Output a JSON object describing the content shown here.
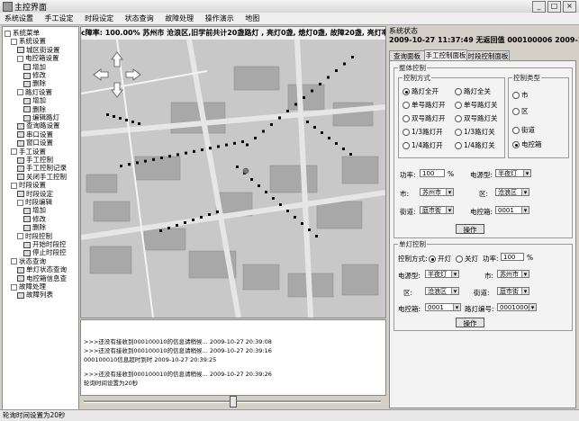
{
  "window": {
    "title": "主控界面",
    "min": "_",
    "max": "□",
    "close": "×"
  },
  "menu": [
    "系统设置",
    "手工设定",
    "时段设定",
    "状态查询",
    "故障处理",
    "操作演示",
    "地图"
  ],
  "tree": [
    {
      "label": "系统菜单",
      "level": 0,
      "kind": "pm"
    },
    {
      "label": "系统设置",
      "level": 1,
      "kind": "pm"
    },
    {
      "label": "城区街设置",
      "level": 2,
      "kind": "fi"
    },
    {
      "label": "电控箱设置",
      "level": 2,
      "kind": "pm"
    },
    {
      "label": "增加",
      "level": 3,
      "kind": "fi"
    },
    {
      "label": "修改",
      "level": 3,
      "kind": "fi"
    },
    {
      "label": "删除",
      "level": 3,
      "kind": "fi"
    },
    {
      "label": "路灯设置",
      "level": 2,
      "kind": "pm"
    },
    {
      "label": "增加",
      "level": 3,
      "kind": "fi"
    },
    {
      "label": "删除",
      "level": 3,
      "kind": "fi"
    },
    {
      "label": "编辑路灯",
      "level": 3,
      "kind": "fi"
    },
    {
      "label": "查询路设置",
      "level": 2,
      "kind": "fi"
    },
    {
      "label": "串口设置",
      "level": 2,
      "kind": "fi"
    },
    {
      "label": "窗口设置",
      "level": 2,
      "kind": "fi"
    },
    {
      "label": "手工设置",
      "level": 1,
      "kind": "pm"
    },
    {
      "label": "手工控制",
      "level": 2,
      "kind": "fi"
    },
    {
      "label": "手工控制记录",
      "level": 2,
      "kind": "fi"
    },
    {
      "label": "关闭手工控制",
      "level": 2,
      "kind": "fi"
    },
    {
      "label": "时段设置",
      "level": 1,
      "kind": "pm"
    },
    {
      "label": "时段设定",
      "level": 2,
      "kind": "fi"
    },
    {
      "label": "时段编辑",
      "level": 2,
      "kind": "pm"
    },
    {
      "label": "增加",
      "level": 3,
      "kind": "fi"
    },
    {
      "label": "修改",
      "level": 3,
      "kind": "fi"
    },
    {
      "label": "删除",
      "level": 3,
      "kind": "fi"
    },
    {
      "label": "时段控制",
      "level": 2,
      "kind": "pm"
    },
    {
      "label": "开始时段控",
      "level": 3,
      "kind": "fi"
    },
    {
      "label": "停止时段控",
      "level": 3,
      "kind": "fi"
    },
    {
      "label": "状态查询",
      "level": 1,
      "kind": "pm"
    },
    {
      "label": "单灯状态查询",
      "level": 2,
      "kind": "fi"
    },
    {
      "label": "电控箱信息查",
      "level": 2,
      "kind": "fi"
    },
    {
      "label": "故障处理",
      "level": 1,
      "kind": "pm"
    },
    {
      "label": "故障列表",
      "level": 2,
      "kind": "fi"
    }
  ],
  "map_status": "c障率: 100.00%    苏州市 沧浪区,旧学前共计20盏路灯 , 亮灯0盏, 熄灯0盏, 故障20盏, 亮灯率",
  "log": [
    ">>>还没有接收到000100010的信息请稍候...  2009-10-27 20:39:08",
    ">>>还没有接收到000100010的信息请稍候...  2009-10-27 20:39:16",
    "000100010信息超时到时 2009-10-27 20:39:25",
    ">>>还没有接收到000100010的信息请稍候...  2009-10-27 20:39:26",
    "轮询时间设置为20秒"
  ],
  "status_bar": "轮询时间设置为20秒",
  "right": {
    "header": "系统状态",
    "clock": "2009-10-27 11:37:49  无返回值 000100006   2009-10-27",
    "tabs": [
      "查询面板",
      "手工控制面板",
      "时段控制面板"
    ],
    "group_all": "整体控制",
    "group_mode": "控制方式",
    "modes": [
      "全开",
      "全关",
      "单号开",
      "单号关",
      "双号开",
      "双号关",
      "1/3开",
      "1/3关",
      "1/4开",
      "1/4关"
    ],
    "mode_labels": [
      "路灯全开",
      "路灯全关",
      "单号路灯开",
      "单号路灯关",
      "双号路灯开",
      "双号路灯关",
      "1/3路灯开",
      "1/3路灯关",
      "1/4路灯开",
      "1/4路灯关"
    ],
    "group_type": "控制类型",
    "types": [
      "市",
      "区",
      "街道",
      "电控箱"
    ],
    "power_label": "功率:",
    "power_value": "100",
    "power_unit": "%",
    "box_type_label": "电源型:",
    "box_type_value": "半夜灯",
    "city_label": "市:",
    "city_value": "苏州市",
    "district_label": "区:",
    "district_value": "沧浪区",
    "street_label": "街道:",
    "street_value": "庭市街",
    "cabinet_label": "电控箱:",
    "cabinet_value": "0001",
    "op_button": "操作",
    "group_single": "单灯控制",
    "single_control_label": "控制方式:",
    "on_label": "开灯",
    "off_label": "关灯",
    "single_power_label": "功率:",
    "single_power_value": "100",
    "single_power_unit": "%",
    "single_type_label": "电源型:",
    "single_type_value": "半夜灯",
    "single_city_label": "市:",
    "single_city_value": "苏州市",
    "single_district_label": "区:",
    "single_district_value": "沧浪区",
    "single_street_label": "街道:",
    "single_street_value": "庭市街",
    "single_cabinet_label": "电控箱:",
    "single_cabinet_value": "0001",
    "lamp_no_label": "路灯编号:",
    "lamp_no_value": "000100001",
    "single_op_button": "操作"
  },
  "colors": {
    "frame": "#d4d0c8",
    "map": "#cfcfcf",
    "dots": "#000000"
  }
}
